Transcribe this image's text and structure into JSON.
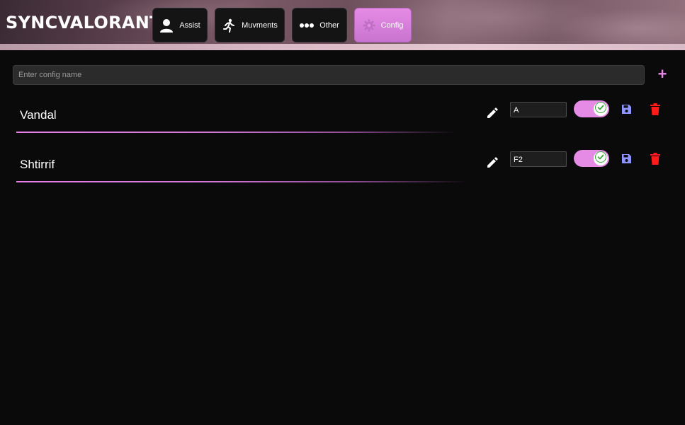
{
  "app": {
    "brand": "SYNCVALORANT"
  },
  "nav": {
    "tabs": [
      {
        "label": "Assist",
        "icon": "user-icon",
        "active": false
      },
      {
        "label": "Muvments",
        "icon": "running-icon",
        "active": false
      },
      {
        "label": "Other",
        "icon": "more-dots-icon",
        "active": false
      },
      {
        "label": "Config",
        "icon": "gear-icon",
        "active": true
      }
    ]
  },
  "config": {
    "name_input": {
      "value": "",
      "placeholder": "Enter config name"
    },
    "add_icon": "plus-icon",
    "items": [
      {
        "name": "Vandal",
        "key": "A",
        "enabled": true
      },
      {
        "name": "Shtirrif",
        "key": "F2",
        "enabled": true
      }
    ]
  },
  "colors": {
    "accent": "#e58be5",
    "background": "#0b0a0b",
    "save": "#8f95ff",
    "delete": "#ff1a1a",
    "check": "#3aa83a"
  }
}
